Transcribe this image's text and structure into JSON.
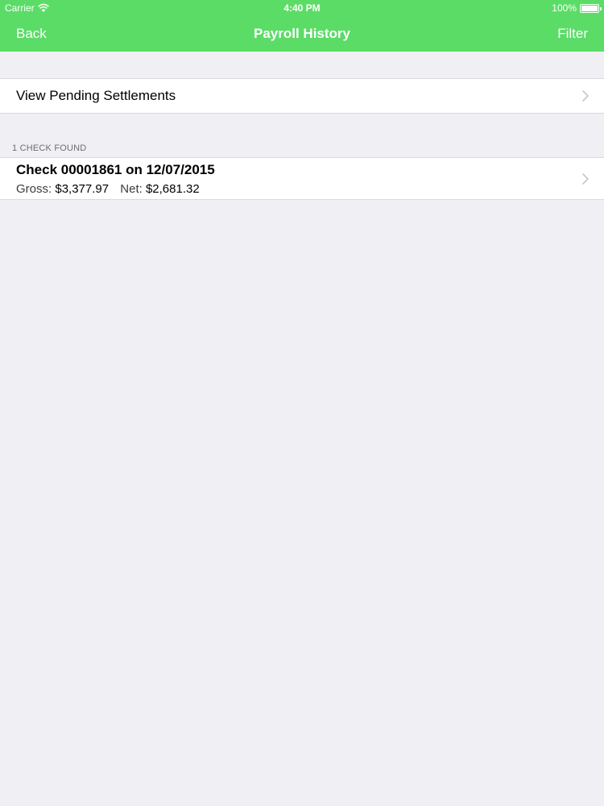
{
  "status_bar": {
    "carrier": "Carrier",
    "time": "4:40 PM",
    "battery": "100%",
    "wifi_icon": "wifi-icon",
    "battery_icon": "battery-icon"
  },
  "nav": {
    "back_label": "Back",
    "title": "Payroll History",
    "filter_label": "Filter"
  },
  "pending": {
    "label": "View Pending Settlements"
  },
  "section": {
    "header": "1 CHECK FOUND"
  },
  "checks": [
    {
      "title": "Check 00001861 on 12/07/2015",
      "gross_label": "Gross:",
      "gross_value": "$3,377.97",
      "net_label": "Net:",
      "net_value": "$2,681.32"
    }
  ],
  "colors": {
    "nav_background": "#5bdc67",
    "page_background": "#efeff4"
  }
}
